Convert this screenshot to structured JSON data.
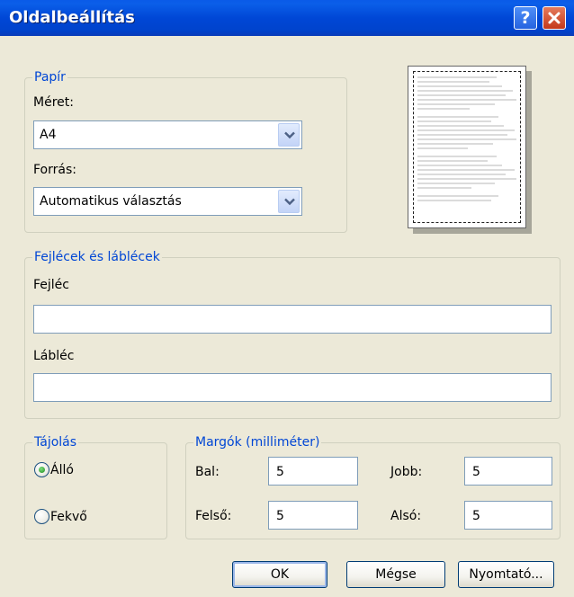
{
  "window": {
    "title": "Oldalbeállítás"
  },
  "titlebar": {
    "help_label": "?",
    "help_icon": "question-icon",
    "close_icon": "close-x-icon"
  },
  "paper": {
    "legend": "Papír",
    "size_label": "Méret:",
    "size_value": "A4",
    "source_label": "Forrás:",
    "source_value": "Automatikus választás"
  },
  "headers": {
    "legend": "Fejlécek és láblécek",
    "header_label": "Fejléc",
    "header_value": "",
    "footer_label": "Lábléc",
    "footer_value": ""
  },
  "orientation": {
    "legend": "Tájolás",
    "portrait_label": "Álló",
    "landscape_label": "Fekvő",
    "selected": "portrait"
  },
  "margins": {
    "legend": "Margók (milliméter)",
    "left_label": "Bal:",
    "left_value": "5",
    "right_label": "Jobb:",
    "right_value": "5",
    "top_label": "Felső:",
    "top_value": "5",
    "bottom_label": "Alsó:",
    "bottom_value": "5"
  },
  "buttons": {
    "ok": "OK",
    "cancel": "Mégse",
    "printer": "Nyomtató..."
  },
  "colors": {
    "titlebar": "#0047d6",
    "dialog_bg": "#ece9d8",
    "legend_text": "#0046d5",
    "field_border": "#7f9db9"
  }
}
